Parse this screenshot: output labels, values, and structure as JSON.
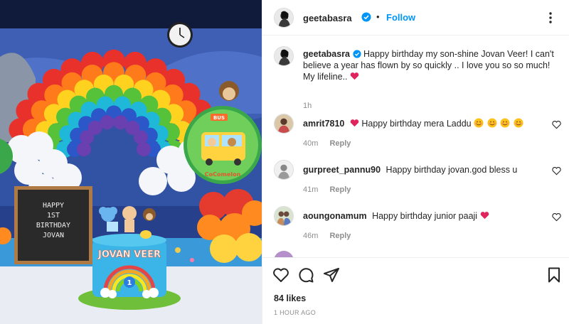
{
  "header": {
    "username": "geetabasra",
    "separator": "•",
    "follow_label": "Follow",
    "more_icon": "more-options-icon"
  },
  "caption": {
    "username": "geetabasra",
    "text": "Happy birthday my son-shine Jovan Veer! I can't believe a year has flown by so quickly .. I love you so so much! My lifeline..",
    "time": "1h"
  },
  "comments": [
    {
      "username": "amrit7810",
      "text": "Happy birthday mera Laddu",
      "time": "40m",
      "reply": "Reply"
    },
    {
      "username": "gurpreet_pannu90",
      "text": "Happy birthday jovan.god bless u",
      "time": "41m",
      "reply": "Reply"
    },
    {
      "username": "aoungonamum",
      "text": "Happy birthday junior paaji",
      "time": "46m",
      "reply": "Reply"
    }
  ],
  "photo": {
    "board_text": [
      "HAPPY",
      "1ST",
      "BIRTHDAY",
      "JOVAN"
    ],
    "cake_text": "JOVAN VEER",
    "cake_number": "1",
    "bus_sign": "BUS",
    "balloon_brand": "CoComelon"
  },
  "footer": {
    "likes": "84 likes",
    "posted": "1 HOUR AGO"
  },
  "colors": {
    "accent_blue": "#0095f6",
    "heart_red": "#ed4956",
    "muted_text": "#8e8e8e"
  }
}
